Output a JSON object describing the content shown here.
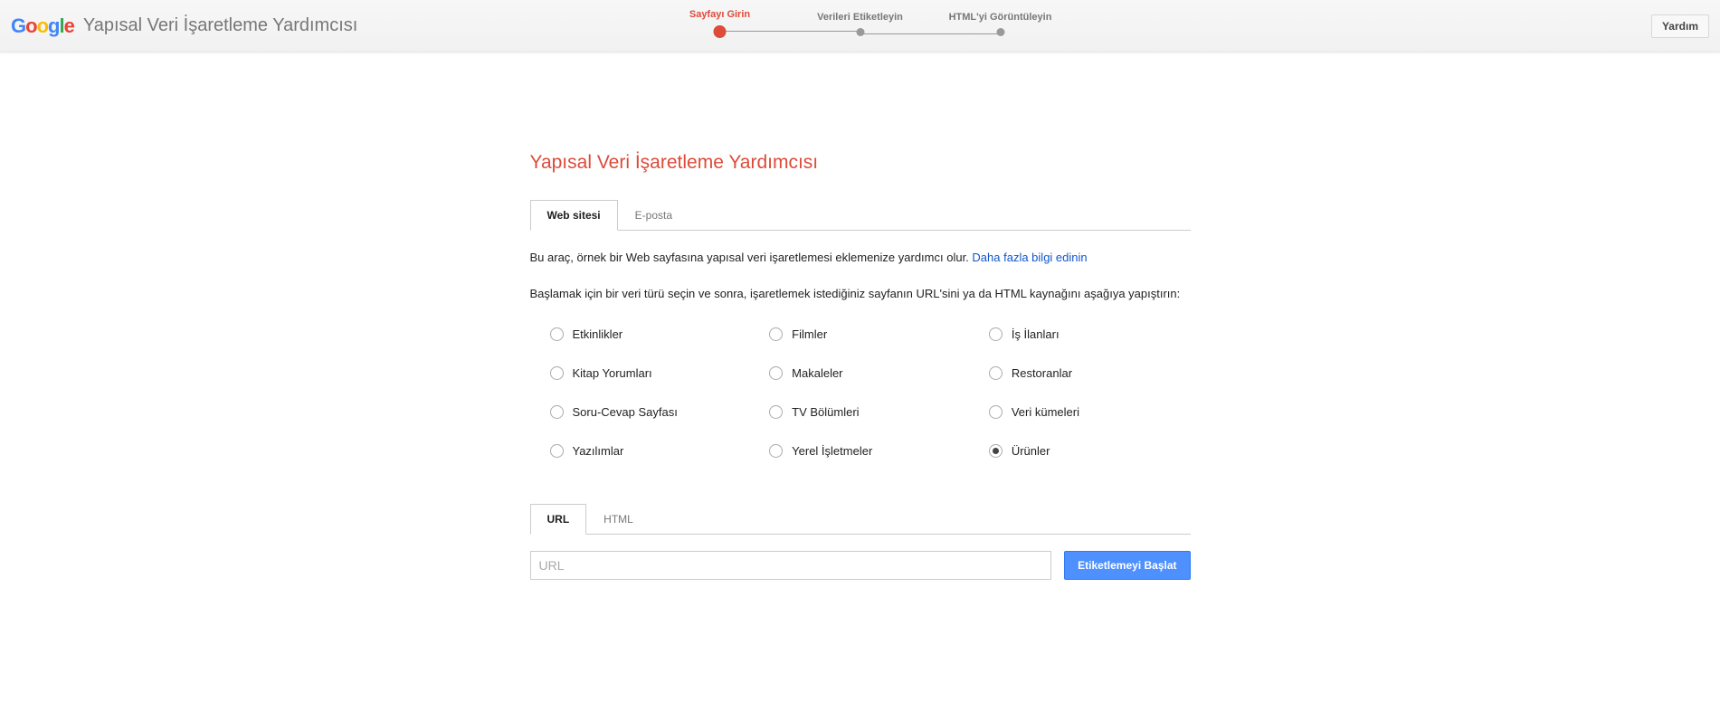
{
  "header": {
    "app_title": "Yapısal Veri İşaretleme Yardımcısı",
    "steps": {
      "step1": "Sayfayı Girin",
      "step2": "Verileri Etiketleyin",
      "step3": "HTML'yi Görüntüleyin"
    },
    "help_label": "Yardım"
  },
  "main": {
    "title": "Yapısal Veri İşaretleme Yardımcısı",
    "tabs": {
      "website": "Web sitesi",
      "email": "E-posta"
    },
    "desc_text": "Bu araç, örnek bir Web sayfasına yapısal veri işaretlemesi eklemenize yardımcı olur. ",
    "desc_link": "Daha fazla bilgi edinin",
    "desc2": "Başlamak için bir veri türü seçin ve sonra, işaretlemek istediğiniz sayfanın URL'sini ya da HTML kaynağını aşağıya yapıştırın:",
    "radios": {
      "r0": "Etkinlikler",
      "r1": "Filmler",
      "r2": "İş İlanları",
      "r3": "Kitap Yorumları",
      "r4": "Makaleler",
      "r5": "Restoranlar",
      "r6": "Soru-Cevap Sayfası",
      "r7": "TV Bölümleri",
      "r8": "Veri kümeleri",
      "r9": "Yazılımlar",
      "r10": "Yerel İşletmeler",
      "r11": "Ürünler"
    },
    "input_tabs": {
      "url": "URL",
      "html": "HTML"
    },
    "url_placeholder": "URL",
    "start_label": "Etiketlemeyi Başlat"
  }
}
